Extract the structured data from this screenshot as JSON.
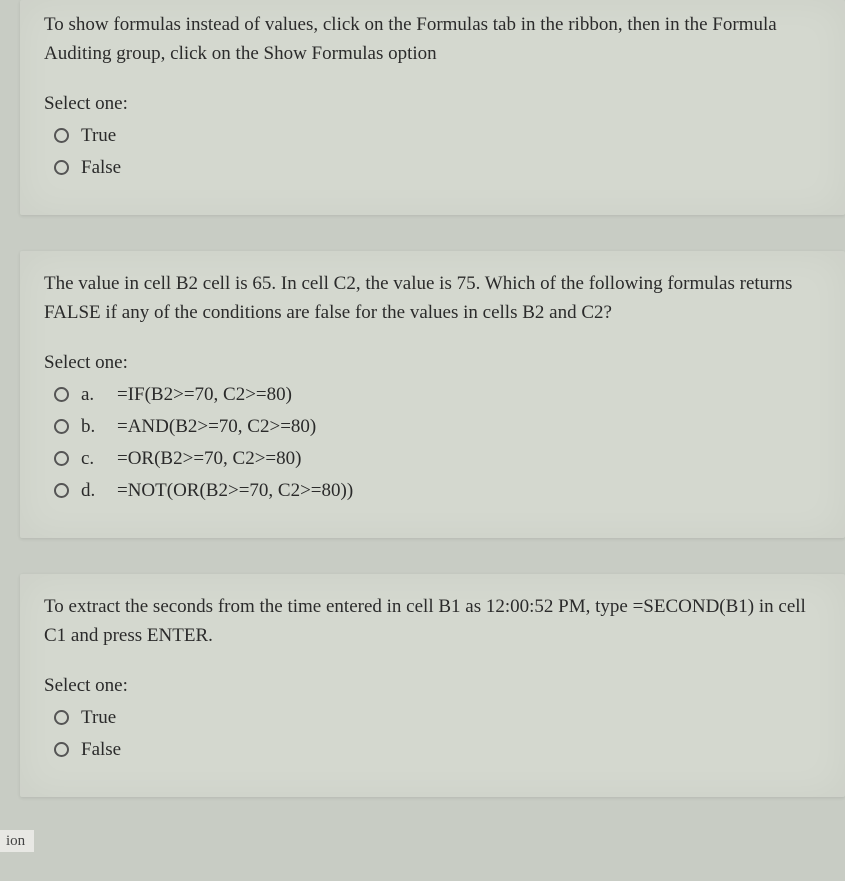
{
  "questions": [
    {
      "prompt": "To show formulas instead of values, click on the Formulas tab in the ribbon, then in the Formula Auditing group, click on the Show Formulas option",
      "selectLabel": "Select one:",
      "options": [
        {
          "label": "True"
        },
        {
          "label": "False"
        }
      ]
    },
    {
      "prompt": "The value in cell B2 cell is 65. In cell C2, the value is 75. Which of the following formulas returns FALSE if any of the conditions are false for the values in cells B2 and C2?",
      "selectLabel": "Select one:",
      "options": [
        {
          "letter": "a.",
          "label": "=IF(B2>=70, C2>=80)"
        },
        {
          "letter": "b.",
          "label": "=AND(B2>=70, C2>=80)"
        },
        {
          "letter": "c.",
          "label": "=OR(B2>=70, C2>=80)"
        },
        {
          "letter": "d.",
          "label": "=NOT(OR(B2>=70, C2>=80))"
        }
      ]
    },
    {
      "prompt": "To extract the seconds from the time entered in cell B1 as 12:00:52 PM, type =SECOND(B1) in cell C1 and press ENTER.",
      "selectLabel": "Select one:",
      "options": [
        {
          "label": "True"
        },
        {
          "label": "False"
        }
      ]
    }
  ],
  "sidebar": {
    "ionLabel": "ion"
  }
}
